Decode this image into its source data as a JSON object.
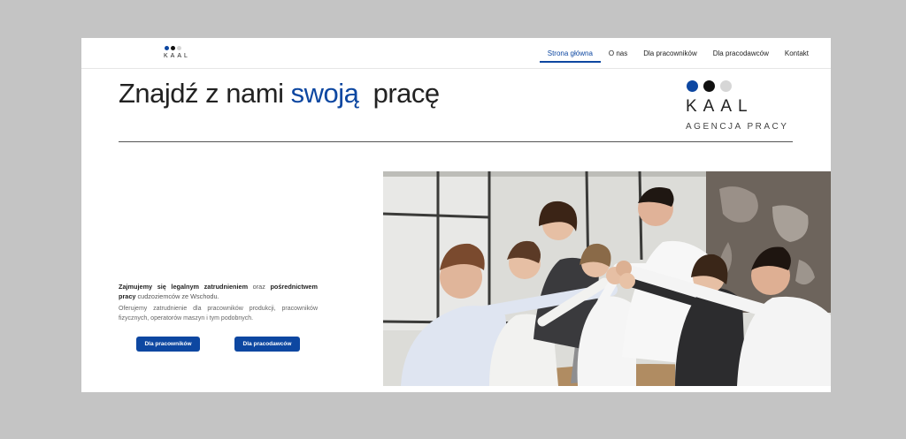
{
  "brand": {
    "name": "KAAL",
    "tagline": "AGENCJA PRACY",
    "dot_colors": [
      "#0d47a1",
      "#111111",
      "#d6d6d6"
    ]
  },
  "nav": {
    "items": [
      {
        "label": "Strona główna",
        "active": true
      },
      {
        "label": "O nas",
        "active": false
      },
      {
        "label": "Dla pracowników",
        "active": false
      },
      {
        "label": "Dla pracodawców",
        "active": false
      },
      {
        "label": "Kontakt",
        "active": false
      }
    ]
  },
  "hero": {
    "headline_before": "Znajdź z nami",
    "headline_accent": "swoją",
    "headline_after": "pracę"
  },
  "intro": {
    "p1_b1": "Zajmujemy się legalnym zatrudnieniem",
    "p1_t1": "oraz",
    "p1_b2": "pośrednictwem pracy",
    "p1_t2": "cudzoziemców ze Wschodu.",
    "p2": "Oferujemy zatrudnienie dla pracowników produkcji, pracowników fizycznych, operatorów maszyn i tym podobnych."
  },
  "buttons": {
    "workers": "Dla pracowników",
    "employers": "Dla pracodawców"
  },
  "photo": {
    "subject": "team-high-five-photo"
  },
  "colors": {
    "accent": "#0d47a1",
    "frame": "#c4c4c4"
  }
}
